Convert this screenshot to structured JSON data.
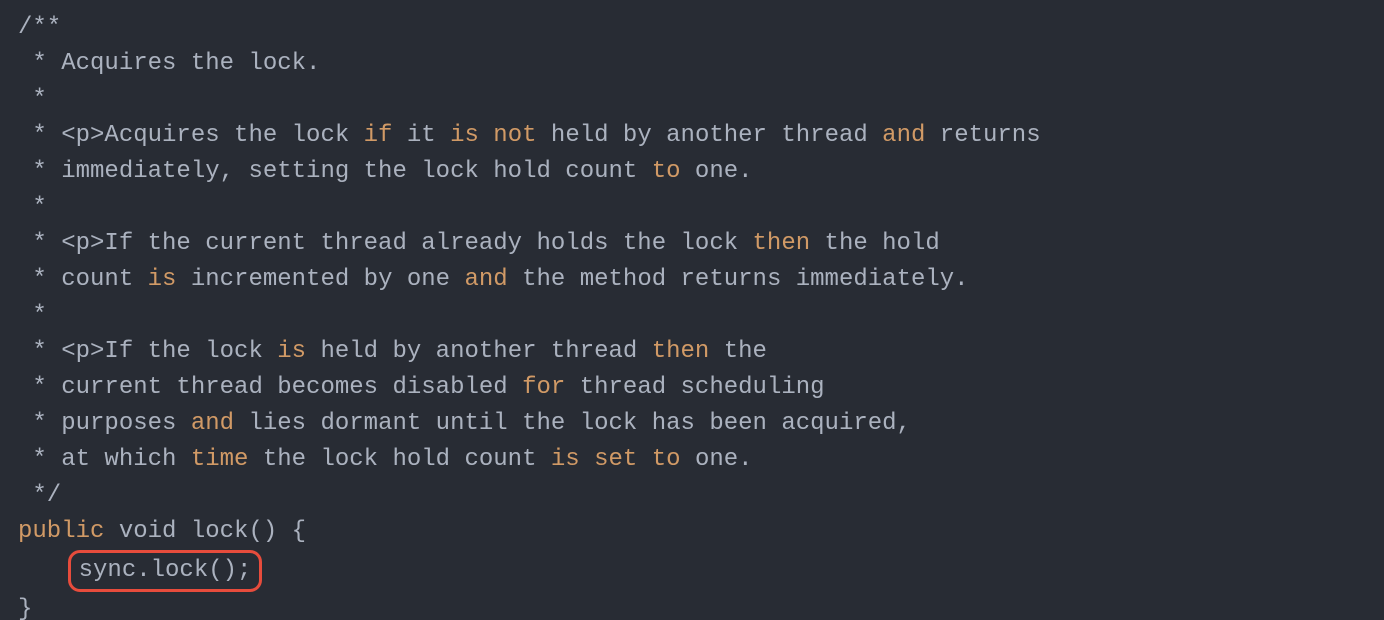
{
  "snippet": {
    "l1": "/**",
    "l2a": " * Acquires the lock.",
    "l3": " *",
    "l4a": " * <p>Acquires the lock ",
    "l4b": "if",
    "l4c": " it ",
    "l4d": "is",
    "l4e": " ",
    "l4f": "not",
    "l4g": " held by another thread ",
    "l4h": "and",
    "l4i": " returns",
    "l5a": " * immediately, setting the lock hold count ",
    "l5b": "to",
    "l5c": " one.",
    "l6": " *",
    "l7a": " * <p>If the current thread already holds the lock ",
    "l7b": "then",
    "l7c": " the hold",
    "l8a": " * count ",
    "l8b": "is",
    "l8c": " incremented by one ",
    "l8d": "and",
    "l8e": " the method returns immediately.",
    "l9": " *",
    "l10a": " * <p>If the lock ",
    "l10b": "is",
    "l10c": " held by another thread ",
    "l10d": "then",
    "l10e": " the",
    "l11a": " * current thread becomes disabled ",
    "l11b": "for",
    "l11c": " thread scheduling",
    "l12a": " * purposes ",
    "l12b": "and",
    "l12c": " lies dormant until the lock has been acquired,",
    "l13a": " * at which ",
    "l13b": "time",
    "l13c": " the lock hold count ",
    "l13d": "is",
    "l13e": " ",
    "l13f": "set",
    "l13g": " ",
    "l13h": "to",
    "l13i": " one.",
    "l14": " */",
    "l15a": "public",
    "l15b": " void lock() {",
    "l16a": "    ",
    "l16b": "sync.lock();",
    "l17": "}"
  }
}
